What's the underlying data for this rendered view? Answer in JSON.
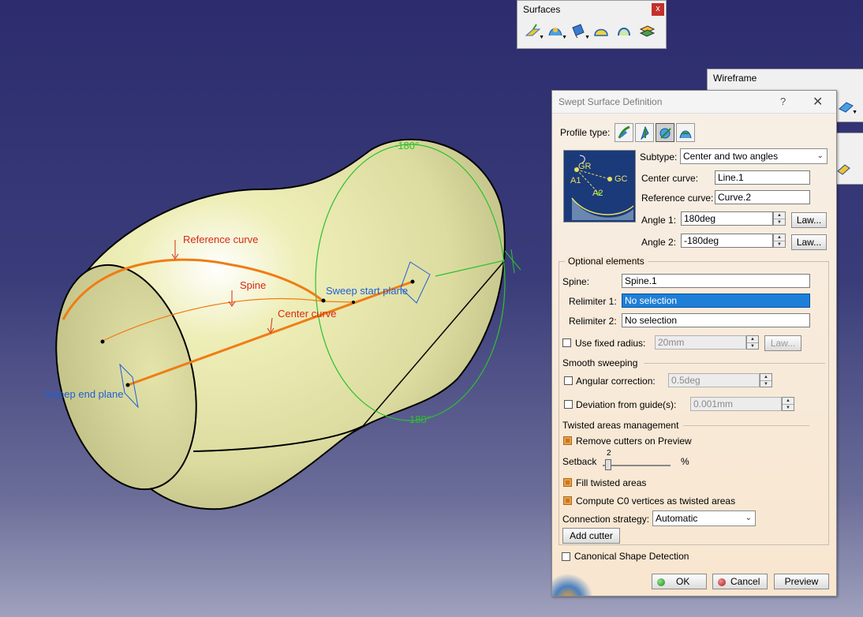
{
  "viewport": {
    "labels": {
      "reference_curve": "Reference curve",
      "spine": "Spine",
      "center_curve": "Center curve",
      "sweep_start_plane": "Sweep start plane",
      "sweep_end_plane": "Sweep end plane",
      "angle_top": "-180°",
      "angle_bottom": "180°"
    }
  },
  "toolbars": {
    "surfaces": {
      "title": "Surfaces",
      "close": "x"
    },
    "wireframe": {
      "title": "Wireframe"
    }
  },
  "dialog": {
    "title": "Swept Surface Definition",
    "help": "?",
    "close": "✕",
    "profile_type_label": "Profile type:",
    "diagram_labels": {
      "gr": "GR",
      "gc": "GC",
      "a1": "A1",
      "a2": "A2"
    },
    "subtype_label": "Subtype:",
    "subtype_value": "Center and two angles",
    "center_curve_label": "Center curve:",
    "center_curve_value": "Line.1",
    "reference_curve_label": "Reference curve:",
    "reference_curve_value": "Curve.2",
    "angle1_label": "Angle 1:",
    "angle1_value": "180deg",
    "angle2_label": "Angle 2:",
    "angle2_value": "-180deg",
    "law_label": "Law...",
    "optional_elements_label": "Optional elements",
    "spine_label": "Spine:",
    "spine_value": "Spine.1",
    "relimiter1_label": "Relimiter 1:",
    "relimiter1_value": "No selection",
    "relimiter2_label": "Relimiter 2:",
    "relimiter2_value": "No selection",
    "use_fixed_radius_label": "Use fixed radius:",
    "fixed_radius_value": "20mm",
    "smooth_sweeping_label": "Smooth sweeping",
    "angular_correction_label": "Angular correction:",
    "angular_correction_value": "0.5deg",
    "deviation_label": "Deviation from guide(s):",
    "deviation_value": "0.001mm",
    "twisted_areas_label": "Twisted areas management",
    "remove_cutters_label": "Remove cutters on Preview",
    "setback_label": "Setback",
    "setback_value": "2",
    "setback_unit": "%",
    "fill_twisted_label": "Fill twisted areas",
    "compute_c0_label": "Compute C0 vertices as twisted areas",
    "connection_strategy_label": "Connection strategy:",
    "connection_strategy_value": "Automatic",
    "add_cutter_label": "Add cutter",
    "canonical_label": "Canonical Shape Detection",
    "ok_label": "OK",
    "cancel_label": "Cancel",
    "preview_label": "Preview"
  },
  "checks": {
    "use_fixed_radius": false,
    "angular_correction": false,
    "deviation": false,
    "remove_cutters": true,
    "fill_twisted": true,
    "compute_c0": true,
    "canonical": false
  },
  "colors": {
    "surface": "#e6e6a8",
    "curve_orange": "#f07c14",
    "label_red": "#d82a10",
    "label_blue": "#1f5fd6",
    "circle_green": "#2ec02e",
    "selection_blue": "#1e7fd8"
  }
}
